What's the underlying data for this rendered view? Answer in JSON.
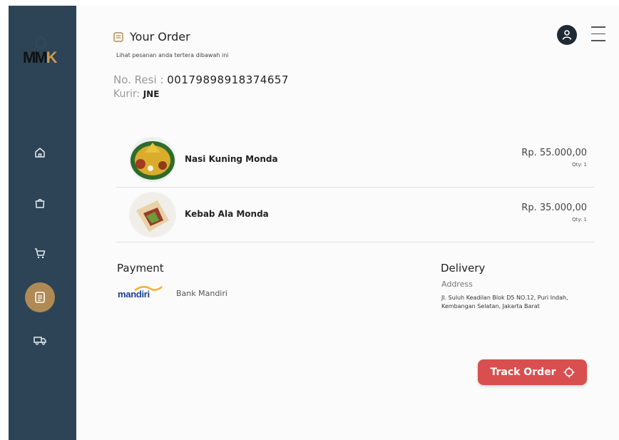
{
  "brand": {
    "logo_text_primary": "MM",
    "logo_text_accent": "K"
  },
  "sidebar": {
    "items": [
      {
        "icon": "home-icon"
      },
      {
        "icon": "shopping-bag-icon"
      },
      {
        "icon": "cart-icon"
      },
      {
        "icon": "order-receipt-icon",
        "active": true
      },
      {
        "icon": "delivery-truck-icon"
      }
    ]
  },
  "header": {
    "title": "Your Order",
    "subtitle": "Lihat pesanan anda tertera dibawah ini"
  },
  "order": {
    "resi_label": "No. Resi :",
    "resi_value": "00179898918374657",
    "kurir_label": "Kurir:",
    "kurir_value": "JNE"
  },
  "items": [
    {
      "name": "Nasi Kuning Monda",
      "price": "Rp. 55.000,00",
      "qty": "Qty: 1"
    },
    {
      "name": "Kebab Ala Monda",
      "price": "Rp. 35.000,00",
      "qty": "Qty: 1"
    }
  ],
  "payment": {
    "title": "Payment",
    "logo_text": "mandiri",
    "bank_name": "Bank Mandiri"
  },
  "delivery": {
    "title": "Delivery",
    "address_label": "Address",
    "address": "Jl. Suluh Keadilan Blok D5 NO.12, Puri Indah, Kembangan Selatan, Jakarta Barat"
  },
  "actions": {
    "track_label": "Track Order"
  },
  "colors": {
    "sidebar": "#2d4457",
    "accent_gold": "#b08a55",
    "track_button": "#d94f4f",
    "mandiri_blue": "#1a3f8f"
  }
}
